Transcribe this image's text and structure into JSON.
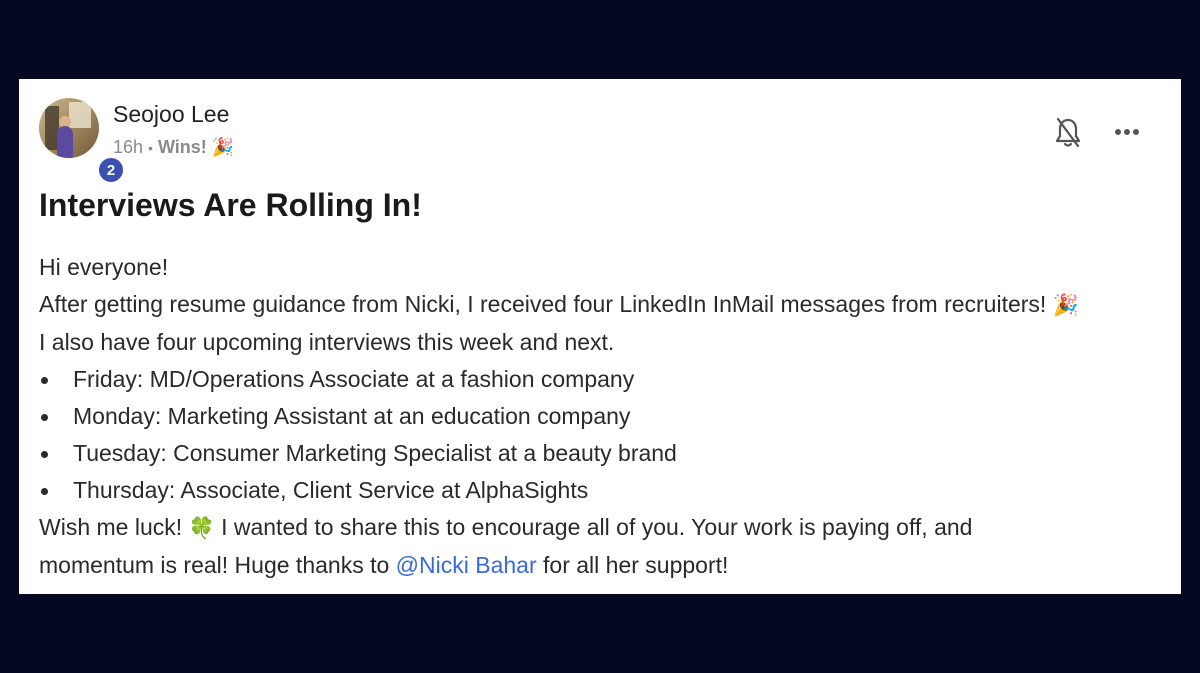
{
  "post": {
    "author": {
      "name": "Seojoo Lee",
      "badge_count": "2"
    },
    "meta": {
      "time": "16h",
      "separator": "•",
      "category": "Wins!",
      "category_emoji": "🎉"
    },
    "title": "Interviews Are Rolling In!",
    "body": {
      "greeting": "Hi everyone!",
      "line1": "After getting resume guidance from Nicki, I received four LinkedIn InMail messages from recruiters!",
      "line1_emoji": "🎉",
      "line2": "I also have four upcoming interviews this week and next.",
      "bullets": [
        "Friday: MD/Operations Associate at a fashion company",
        "Monday: Marketing Assistant at an education company",
        "Tuesday: Consumer Marketing Specialist at a beauty brand",
        "Thursday: Associate, Client Service at AlphaSights"
      ],
      "closing_pre": "Wish me luck!",
      "closing_emoji": "🍀",
      "closing_post": "I wanted to share this to encourage all of you. Your work is paying off, and",
      "final_pre": "momentum is real! Huge thanks to",
      "mention": "@Nicki Bahar",
      "final_post": "for all her support!"
    }
  },
  "icons": {
    "notification": "bell-off-icon",
    "more": "more-options-icon"
  },
  "colors": {
    "background": "#040820",
    "badge": "#3b4fb0",
    "mention": "#3a6ad8"
  }
}
